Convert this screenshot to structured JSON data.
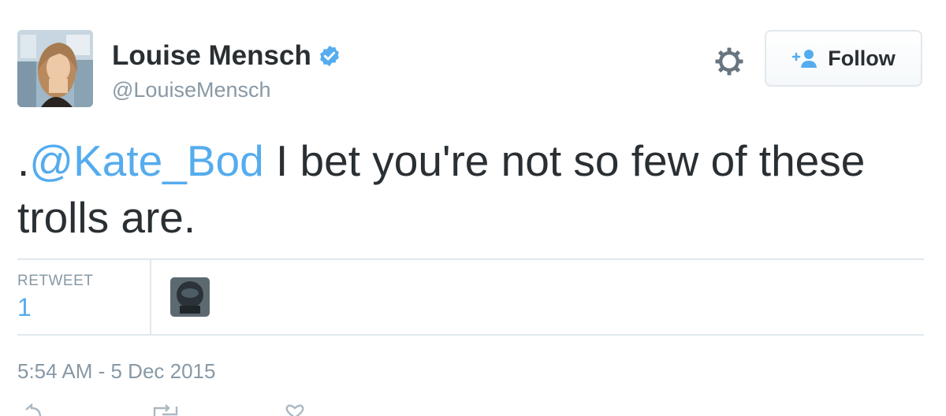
{
  "author": {
    "display_name": "Louise Mensch",
    "handle": "@LouiseMensch",
    "verified": true
  },
  "header": {
    "follow_label": "Follow"
  },
  "tweet": {
    "prefix": ".",
    "mention": "@Kate_Bod",
    "text": " I bet you're not so few of these trolls are."
  },
  "stats": {
    "retweet_label": "RETWEET",
    "retweet_count": "1"
  },
  "timestamp": "5:54 AM - 5 Dec 2015",
  "colors": {
    "link": "#55acee",
    "text": "#292f33",
    "muted": "#8899a6",
    "border": "#e1e8ed"
  },
  "icons": {
    "verified": "verified-badge-icon",
    "settings": "gear-icon",
    "follow": "add-person-icon",
    "reply": "reply-icon",
    "retweet": "retweet-icon",
    "like": "heart-icon"
  }
}
